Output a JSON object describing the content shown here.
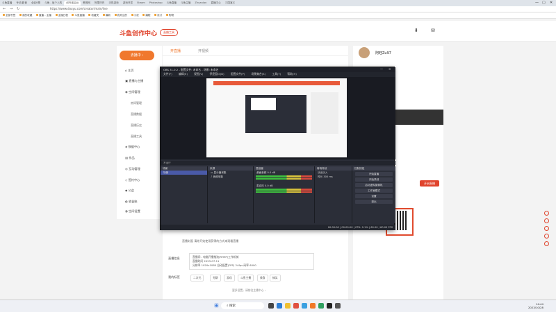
{
  "browser": {
    "url": "https://www.douyu.com/creator/main/live",
    "tabs": [
      "斗鱼直播",
      "专访|影音",
      "全民K歌",
      "斗鱼 - 每个人的",
      "创作者后台",
      "教育网",
      "阿里巴巴",
      "手机游戏",
      "游戏开发",
      "Steam",
      "Photoshop",
      "斗鱼直播",
      "斗鱼主播",
      "Zhuanlan",
      "直播中心",
      "三国演义"
    ],
    "bookmarks": [
      "全部书签",
      "我的收藏",
      "直播 - 主播",
      "主播日程",
      "斗鱼直播",
      "收藏夹",
      "最新",
      "我关注的",
      "小说",
      "编程",
      "设计",
      "购物"
    ]
  },
  "site": {
    "logo": "斗鱼创作中心",
    "badge": "直播工具",
    "start_live": "去播中 ›",
    "nav": [
      {
        "label": "主页",
        "icon": "home-icon"
      },
      {
        "label": "直播与主播",
        "icon": "tv-icon"
      },
      {
        "label": "空间管理",
        "icon": "location-icon"
      }
    ],
    "nav_sub": [
      "房间管理",
      "直播数据",
      "直播历史",
      "直播工具"
    ],
    "nav2": [
      "数据中心",
      "作品",
      "互动管理",
      "签约中心",
      "公会",
      "收益账",
      "空间设置"
    ],
    "tabs": [
      "开直播",
      "开视频"
    ],
    "user": {
      "name": "阿旺Zu97"
    },
    "cta": "开启直播"
  },
  "obs": {
    "title": "OBS 31.0.2 - 配置文件: 未命名 - 场景: 未命名",
    "menu": [
      "文件(F)",
      "编辑(E)",
      "视图(V)",
      "停靠窗口(D)",
      "配置文件(P)",
      "场景集合(S)",
      "工具(T)",
      "帮助(H)"
    ],
    "toolbar": "不运行",
    "scenes_header": "场景",
    "scene_items": [
      "场景"
    ],
    "sources_header": "来源",
    "source_items": [
      "显示器采集",
      "音频采集"
    ],
    "mixer_header": "混音器",
    "mixer": [
      {
        "name": "桌面音频",
        "level": "0.0 dB"
      },
      {
        "name": "麦克风",
        "level": "0.0 dB"
      }
    ],
    "transitions_header": "转场特效",
    "transition": "淡出淡入",
    "duration_label": "时长",
    "duration": "300 ms",
    "controls_header": "控制按钮",
    "controls": [
      "开始直播",
      "开始录制",
      "启动虚拟摄像机",
      "工作室模式",
      "设置",
      "退出"
    ],
    "status": "00:00:00 | 00:00:00 | CPU: 0.1% | 60.00 / 60.00 FPS"
  },
  "below": {
    "notice": "直播封面 请你开始使用获得的方式来观看直播 ",
    "live_info_label": "直播信息",
    "live_info": [
      "直播间 - 电脑开播推流(RTMP)工作机械",
      "直播时间  2023-07-11",
      "分辨率  1920x1080  自动配置(FPS)  24fps  码率 6000"
    ],
    "tags_label": "我的标签",
    "tags": [
      "二次元",
      "无聊",
      "游戏",
      "斗鱼主播",
      "美食",
      "搞笑"
    ],
    "bottom_tip": "更多设置，请前往主播中心 ›"
  },
  "taskbar": {
    "search": "搜索",
    "time": "14:44",
    "date": "2023/10/28"
  }
}
